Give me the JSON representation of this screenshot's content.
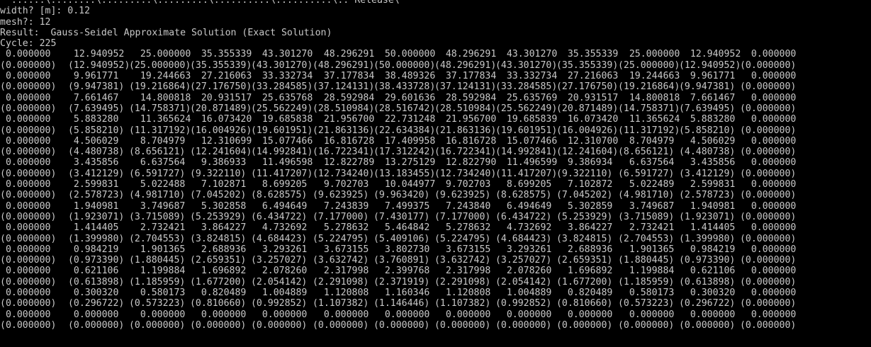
{
  "console": {
    "partial_top_line": "  ......\\........\\.........\\.........\\..........\\..........\\.. Release\\",
    "width_prompt": "width? [m]: 0.12",
    "mesh_prompt": "mesh?: 12",
    "result_line": "Result:  Gauss-Seidel Approximate Solution (Exact Solution)",
    "cycle_line": "Cycle: 225"
  },
  "grid_rows": [
    [
      " 0.000000",
      "  12.940952",
      "   25.000000",
      "   35.355339",
      "   43.301270",
      "   48.296291",
      "   50.000000",
      "   48.296291",
      "   43.301270",
      "   35.355339",
      "   25.000000",
      "   12.940952",
      "   0.000000"
    ],
    [
      "(0.000000)",
      " (12.940952)",
      " (25.000000)",
      " (35.355339)",
      " (43.301270)",
      " (48.296291)",
      " (50.000000)",
      " (48.296291)",
      " (43.301270)",
      " (35.355339)",
      " (25.000000)",
      " (12.940952)",
      " (0.000000)"
    ],
    [
      " 0.000000",
      "  9.961771",
      "   19.244663",
      "   27.216063",
      "   33.332734",
      "   37.177834",
      "   38.489326",
      "   37.177834",
      "   33.332734",
      "   27.216063",
      "   19.244663",
      "   9.961771",
      "   0.000000"
    ],
    [
      "(0.000000)",
      " (9.947381)",
      " (19.216864)",
      " (27.176750)",
      " (33.284585)",
      " (37.124131)",
      " (38.433728)",
      " (37.124131)",
      " (33.284585)",
      " (27.176750)",
      " (19.216864)",
      " (9.947381)",
      " (0.000000)"
    ],
    [
      " 0.000000",
      "  7.661467",
      "   14.800818",
      "   20.931517",
      "   25.635768",
      "   28.592984",
      "   29.601636",
      "   28.592984",
      "   25.635769",
      "   20.931517",
      "   14.800818",
      "   7.661467",
      "   0.000000"
    ],
    [
      "(0.000000)",
      " (7.639495)",
      " (14.758371)",
      " (20.871489)",
      " (25.562249)",
      " (28.510984)",
      " (28.516742)",
      " (28.510984)",
      " (25.562249)",
      " (20.871489)",
      " (14.758371)",
      " (7.639495)",
      " (0.000000)"
    ],
    [
      " 0.000000",
      "  5.883280",
      "   11.365624",
      "   16.073420",
      "   19.685838",
      "   21.956700",
      "   22.731248",
      "   21.956700",
      "   19.685839",
      "   16.073420",
      "   11.365624",
      "   5.883280",
      "   0.000000"
    ],
    [
      "(0.000000)",
      " (5.858210)",
      " (11.317192)",
      " (16.004926)",
      " (19.601951)",
      " (21.863136)",
      " (22.634384)",
      " (21.863136)",
      " (19.601951)",
      " (16.004926)",
      " (11.317192)",
      " (5.858210)",
      " (0.000000)"
    ],
    [
      " 0.000000",
      "  4.506029",
      "   8.704979",
      "   12.310699",
      "   15.077466",
      "   16.816728",
      "   17.409958",
      "   16.816728",
      "   15.077466",
      "   12.310700",
      "   8.704979",
      "   4.506029",
      "   0.000000"
    ],
    [
      "(0.000000)",
      " (4.480738)",
      " (8.656121)",
      " (12.241604)",
      " (14.992841)",
      " (16.722341)",
      " (17.312242)",
      " (16.722341)",
      " (14.992841)",
      " (12.241604)",
      " (8.656121)",
      " (4.480738)",
      " (0.000000)"
    ],
    [
      " 0.000000",
      "  3.435856",
      "   6.637564",
      "   9.386933",
      "   11.496598",
      "   12.822789",
      "   13.275129",
      "   12.822790",
      "   11.496599",
      "   9.386934",
      "   6.637564",
      "   3.435856",
      "   0.000000"
    ],
    [
      "(0.000000)",
      " (3.412129)",
      " (6.591727)",
      " (9.322110)",
      " (11.417207)",
      " (12.734240)",
      " (13.183455)",
      " (12.734240)",
      " (11.417207)",
      " (9.322110)",
      " (6.591727)",
      " (3.412129)",
      " (0.000000)"
    ],
    [
      " 0.000000",
      "  2.599831",
      "   5.022488",
      "   7.102871",
      "   8.699205",
      "   9.702703",
      "   10.044977",
      "   9.702703",
      "   8.699205",
      "   7.102872",
      "   5.022489",
      "   2.599831",
      "   0.000000"
    ],
    [
      "(0.000000)",
      " (2.578723)",
      " (4.981710)",
      " (7.045202)",
      " (8.628575)",
      " (9.623925)",
      " (9.963420)",
      " (9.623925)",
      " (8.628575)",
      " (7.045202)",
      " (4.981710)",
      " (2.578723)",
      " (0.000000)"
    ],
    [
      " 0.000000",
      "  1.940981",
      "   3.749687",
      "   5.302858",
      "   6.494649",
      "   7.243839",
      "   7.499375",
      "   7.243840",
      "   6.494649",
      "   5.302859",
      "   3.749687",
      "   1.940981",
      "   0.000000"
    ],
    [
      "(0.000000)",
      " (1.923071)",
      " (3.715089)",
      " (5.253929)",
      " (6.434722)",
      " (7.177000)",
      " (7.430177)",
      " (7.177000)",
      " (6.434722)",
      " (5.253929)",
      " (3.715089)",
      " (1.923071)",
      " (0.000000)"
    ],
    [
      " 0.000000",
      "  1.414405",
      "   2.732421",
      "   3.864227",
      "   4.732692",
      "   5.278632",
      "   5.464842",
      "   5.278632",
      "   4.732692",
      "   3.864227",
      "   2.732421",
      "   1.414405",
      "   0.000000"
    ],
    [
      "(0.000000)",
      " (1.399980)",
      " (2.704553)",
      " (3.824815)",
      " (4.684423)",
      " (5.224795)",
      " (5.409106)",
      " (5.224795)",
      " (4.684423)",
      " (3.824815)",
      " (2.704553)",
      " (1.399980)",
      " (0.000000)"
    ],
    [
      " 0.000000",
      "  0.984219",
      "   1.901365",
      "   2.688936",
      "   3.293261",
      "   3.673155",
      "   3.802730",
      "   3.673155",
      "   3.293261",
      "   2.688936",
      "   1.901365",
      "   0.984219",
      "   0.000000"
    ],
    [
      "(0.000000)",
      " (0.973390)",
      " (1.880445)",
      " (2.659351)",
      " (3.257027)",
      " (3.632742)",
      " (3.760891)",
      " (3.632742)",
      " (3.257027)",
      " (2.659351)",
      " (1.880445)",
      " (0.973390)",
      " (0.000000)"
    ],
    [
      " 0.000000",
      "  0.621106",
      "   1.199884",
      "   1.696892",
      "   2.078260",
      "   2.317998",
      "   2.399768",
      "   2.317998",
      "   2.078260",
      "   1.696892",
      "   1.199884",
      "   0.621106",
      "   0.000000"
    ],
    [
      "(0.000000)",
      " (0.613898)",
      " (1.185959)",
      " (1.677200)",
      " (2.054142)",
      " (2.291098)",
      " (2.371919)",
      " (2.291098)",
      " (2.054142)",
      " (1.677200)",
      " (1.185959)",
      " (0.613898)",
      " (0.000000)"
    ],
    [
      " 0.000000",
      "  0.300320",
      "   0.580173",
      "   0.820489",
      "   1.004889",
      "   1.120808",
      "   1.160346",
      "   1.120808",
      "   1.004889",
      "   0.820489",
      "   0.580173",
      "   0.300320",
      "   0.000000"
    ],
    [
      "(0.000000)",
      " (0.296722)",
      " (0.573223)",
      " (0.810660)",
      " (0.992852)",
      " (1.107382)",
      " (1.146446)",
      " (1.107382)",
      " (0.992852)",
      " (0.810660)",
      " (0.573223)",
      " (0.296722)",
      " (0.000000)"
    ],
    [
      " 0.000000",
      "  0.000000",
      "   0.000000",
      "   0.000000",
      "   0.000000",
      "   0.000000",
      "   0.000000",
      "   0.000000",
      "   0.000000",
      "   0.000000",
      "   0.000000",
      "   0.000000",
      "   0.000000"
    ],
    [
      "(0.000000)",
      " (0.000000)",
      " (0.000000)",
      " (0.000000)",
      " (0.000000)",
      " (0.000000)",
      " (0.000000)",
      " (0.000000)",
      " (0.000000)",
      " (0.000000)",
      " (0.000000)",
      " (0.000000)",
      " (0.000000)"
    ]
  ]
}
